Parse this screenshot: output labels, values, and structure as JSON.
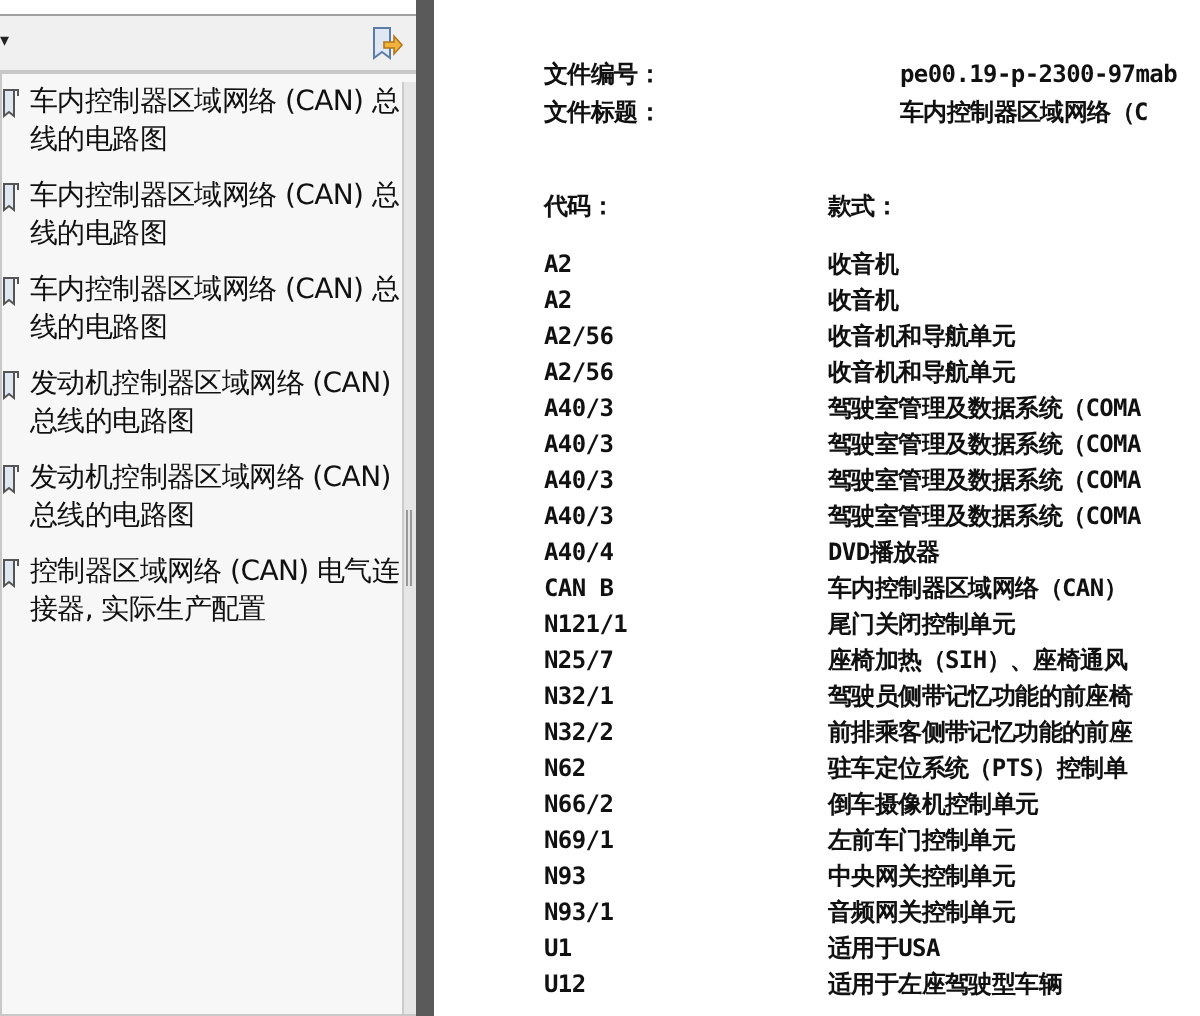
{
  "bookmarks_panel": {
    "toolbar": {
      "menu_caret": "▾"
    },
    "items": [
      {
        "label": "车内控制器区域网络 (CAN) 总线的电路图"
      },
      {
        "label": "车内控制器区域网络 (CAN) 总线的电路图"
      },
      {
        "label": "车内控制器区域网络 (CAN) 总线的电路图"
      },
      {
        "label": "发动机控制器区域网络 (CAN) 总线的电路图"
      },
      {
        "label": "发动机控制器区域网络 (CAN) 总线的电路图"
      },
      {
        "label": "控制器区域网络 (CAN) 电气连接器, 实际生产配置"
      }
    ]
  },
  "document": {
    "fields": [
      {
        "label": "文件编号：",
        "value": "pe00.19-p-2300-97mab"
      },
      {
        "label": "文件标题：",
        "value": "车内控制器区域网络（C"
      }
    ],
    "table": {
      "columns": [
        "代码：",
        "款式："
      ],
      "rows": [
        [
          "A2",
          "收音机"
        ],
        [
          "A2",
          "收音机"
        ],
        [
          "A2/56",
          "收音机和导航单元"
        ],
        [
          "A2/56",
          "收音机和导航单元"
        ],
        [
          "A40/3",
          "驾驶室管理及数据系统（COMA"
        ],
        [
          "A40/3",
          "驾驶室管理及数据系统（COMA"
        ],
        [
          "A40/3",
          "驾驶室管理及数据系统（COMA"
        ],
        [
          "A40/3",
          "驾驶室管理及数据系统（COMA"
        ],
        [
          "A40/4",
          "DVD播放器"
        ],
        [
          "CAN B",
          "车内控制器区域网络（CAN）"
        ],
        [
          "N121/1",
          "尾门关闭控制单元"
        ],
        [
          "N25/7",
          "座椅加热（SIH）、座椅通风"
        ],
        [
          "N32/1",
          "驾驶员侧带记忆功能的前座椅"
        ],
        [
          "N32/2",
          "前排乘客侧带记忆功能的前座"
        ],
        [
          "N62",
          "驻车定位系统（PTS）控制单"
        ],
        [
          "N66/2",
          "倒车摄像机控制单元"
        ],
        [
          "N69/1",
          "左前车门控制单元"
        ],
        [
          "N93",
          "中央网关控制单元"
        ],
        [
          "N93/1",
          "音频网关控制单元"
        ],
        [
          "U1",
          "适用于USA"
        ],
        [
          "U12",
          "适用于左座驾驶型车辆"
        ]
      ]
    }
  }
}
